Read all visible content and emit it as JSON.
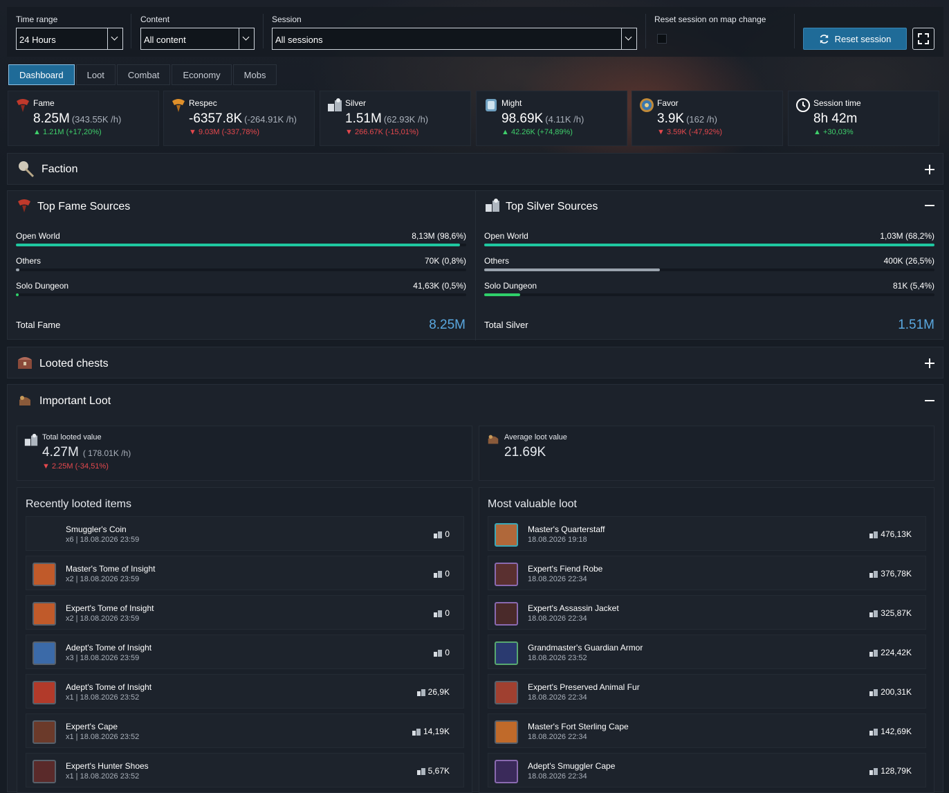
{
  "controls": {
    "time_range": {
      "label": "Time range",
      "value": "24 Hours"
    },
    "content": {
      "label": "Content",
      "value": "All content"
    },
    "session": {
      "label": "Session",
      "value": "All sessions"
    },
    "reset_on_map": {
      "label": "Reset session on map change",
      "checked": false
    },
    "reset_button": "Reset session"
  },
  "tabs": [
    "Dashboard",
    "Loot",
    "Combat",
    "Economy",
    "Mobs"
  ],
  "stats": [
    {
      "icon": "fame-icon",
      "label": "Fame",
      "value": "8.25M",
      "rate": "(343.55K /h)",
      "delta": "1.21M (+17,20%)",
      "trend": "up"
    },
    {
      "icon": "respec-icon",
      "label": "Respec",
      "value": "-6357.8K",
      "rate": "(-264.91K /h)",
      "delta": "9.03M (-337,78%)",
      "trend": "down"
    },
    {
      "icon": "silver-icon",
      "label": "Silver",
      "value": "1.51M",
      "rate": "(62.93K /h)",
      "delta": "266.67K (-15,01%)",
      "trend": "down"
    },
    {
      "icon": "might-icon",
      "label": "Might",
      "value": "98.69K",
      "rate": "(4.11K /h)",
      "delta": "42.26K (+74,89%)",
      "trend": "up"
    },
    {
      "icon": "favor-icon",
      "label": "Favor",
      "value": "3.9K",
      "rate": "(162 /h)",
      "delta": "3.59K (-47,92%)",
      "trend": "down"
    },
    {
      "icon": "clock-icon",
      "label": "Session time",
      "value": "8h 42m",
      "rate": "",
      "delta": "+30,03%",
      "trend": "up"
    }
  ],
  "faction": {
    "title": "Faction"
  },
  "fame_sources": {
    "title": "Top Fame Sources",
    "rows": [
      {
        "name": "Open World",
        "value": "8,13M (98,6%)",
        "pct": 98.6,
        "color": "#1fc8a0"
      },
      {
        "name": "Others",
        "value": "70K (0,8%)",
        "pct": 0.8,
        "color": "#9aa3ad"
      },
      {
        "name": "Solo Dungeon",
        "value": "41,63K (0,5%)",
        "pct": 0.5,
        "color": "#2fd06a"
      }
    ],
    "total_label": "Total Fame",
    "total_value": "8.25M"
  },
  "silver_sources": {
    "title": "Top Silver Sources",
    "rows": [
      {
        "name": "Open World",
        "value": "1,03M (68,2%)",
        "pct": 100,
        "color": "#1fc8a0"
      },
      {
        "name": "Others",
        "value": "400K (26,5%)",
        "pct": 39,
        "color": "#9aa3ad"
      },
      {
        "name": "Solo Dungeon",
        "value": "81K (5,4%)",
        "pct": 8,
        "color": "#2fd06a"
      }
    ],
    "total_label": "Total Silver",
    "total_value": "1.51M"
  },
  "chests": {
    "title": "Looted chests"
  },
  "important_loot": {
    "title": "Important Loot",
    "total": {
      "label": "Total looted value",
      "value": "4.27M",
      "rate": "( 178.01K /h)",
      "delta": "2.25M (-34,51%)"
    },
    "average": {
      "label": "Average loot value",
      "value": "21.69K"
    },
    "recent_title": "Recently looted items",
    "valuable_title": "Most valuable loot",
    "recent": [
      {
        "name": "Smuggler's Coin",
        "meta": "x6  |  18.08.2026 23:59",
        "price": "0",
        "color": ""
      },
      {
        "name": "Master's Tome of Insight",
        "meta": "x2  |  18.08.2026 23:59",
        "price": "0",
        "color": "#c05a2a"
      },
      {
        "name": "Expert's Tome of Insight",
        "meta": "x2  |  18.08.2026 23:59",
        "price": "0",
        "color": "#c05a2a"
      },
      {
        "name": "Adept's Tome of Insight",
        "meta": "x3  |  18.08.2026 23:59",
        "price": "0",
        "color": "#3b6aa8"
      },
      {
        "name": "Adept's Tome of Insight",
        "meta": "x1  |  18.08.2026 23:52",
        "price": "26,9K",
        "color": "#b23a2a"
      },
      {
        "name": "Expert's Cape",
        "meta": "x1  |  18.08.2026 23:52",
        "price": "14,19K",
        "color": "#6b3a2a"
      },
      {
        "name": "Expert's Hunter Shoes",
        "meta": "x1  |  18.08.2026 23:52",
        "price": "5,67K",
        "color": "#5a2a2a"
      }
    ],
    "valuable": [
      {
        "name": "Master's Quarterstaff",
        "meta": "18.08.2026 19:18",
        "price": "476,13K",
        "color": "#b0683a",
        "border": "#3aa8b8"
      },
      {
        "name": "Expert's Fiend Robe",
        "meta": "18.08.2026 22:34",
        "price": "376,78K",
        "color": "#5a3030",
        "border": "#8a6ab0"
      },
      {
        "name": "Expert's Assassin Jacket",
        "meta": "18.08.2026 22:34",
        "price": "325,87K",
        "color": "#4a2a2a",
        "border": "#8a6ab0"
      },
      {
        "name": "Grandmaster's Guardian Armor",
        "meta": "18.08.2026 23:52",
        "price": "224,42K",
        "color": "#2a3a70",
        "border": "#58a870"
      },
      {
        "name": "Expert's Preserved Animal Fur",
        "meta": "18.08.2026 22:34",
        "price": "200,31K",
        "color": "#a04030",
        "border": "#58606a"
      },
      {
        "name": "Master's Fort Sterling Cape",
        "meta": "18.08.2026 22:34",
        "price": "142,69K",
        "color": "#c06a2a",
        "border": "#58606a"
      },
      {
        "name": "Adept's Smuggler Cape",
        "meta": "18.08.2026 22:34",
        "price": "128,79K",
        "color": "#3a2a5a",
        "border": "#8a6ab0"
      }
    ]
  }
}
